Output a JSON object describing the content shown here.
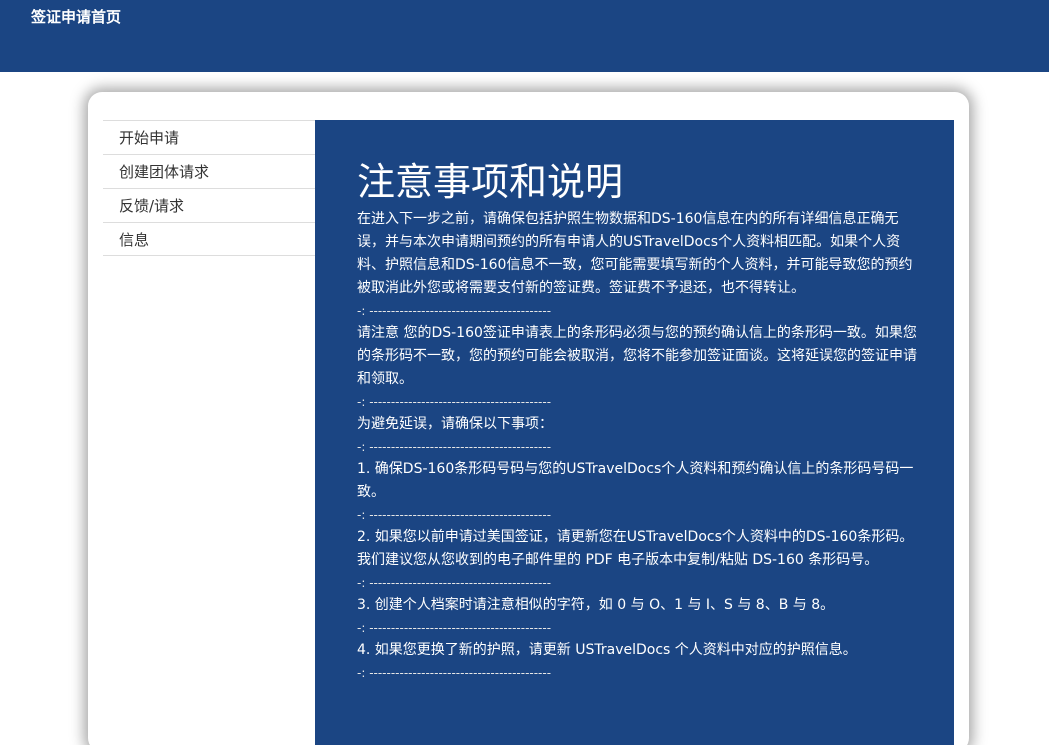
{
  "header": {
    "home_link": "签证申请首页"
  },
  "sidebar": {
    "items": [
      {
        "label": "开始申请"
      },
      {
        "label": "创建团体请求"
      },
      {
        "label": "反馈/请求"
      },
      {
        "label": "信息"
      }
    ]
  },
  "main": {
    "title": "注意事项和说明",
    "separator": "-: ------------------------------------------",
    "paragraphs": [
      "在进入下一步之前，请确保包括护照生物数据和DS-160信息在内的所有详细信息正确无误，并与本次申请期间预约的所有申请人的USTravelDocs个人资料相匹配。如果个人资料、护照信息和DS-160信息不一致，您可能需要填写新的个人资料，并可能导致您的预约被取消此外您或将需要支付新的签证费。签证费不予退还，也不得转让。",
      "请注意 您的DS-160签证申请表上的条形码必须与您的预约确认信上的条形码一致。如果您的条形码不一致，您的预约可能会被取消，您将不能参加签证面谈。这将延误您的签证申请和领取。",
      "为避免延误，请确保以下事项：",
      "1. 确保DS-160条形码号码与您的USTravelDocs个人资料和预约确认信上的条形码号码一致。",
      "2. 如果您以前申请过美国签证，请更新您在USTravelDocs个人资料中的DS-160条形码。我们建议您从您收到的电子邮件里的 PDF 电子版本中复制/粘贴 DS-160 条形码号。",
      "3. 创建个人档案时请注意相似的字符，如 0 与 O、1 与 I、S 与 8、B 与 8。",
      "4. 如果您更换了新的护照，请更新 USTravelDocs 个人资料中对应的护照信息。"
    ]
  }
}
